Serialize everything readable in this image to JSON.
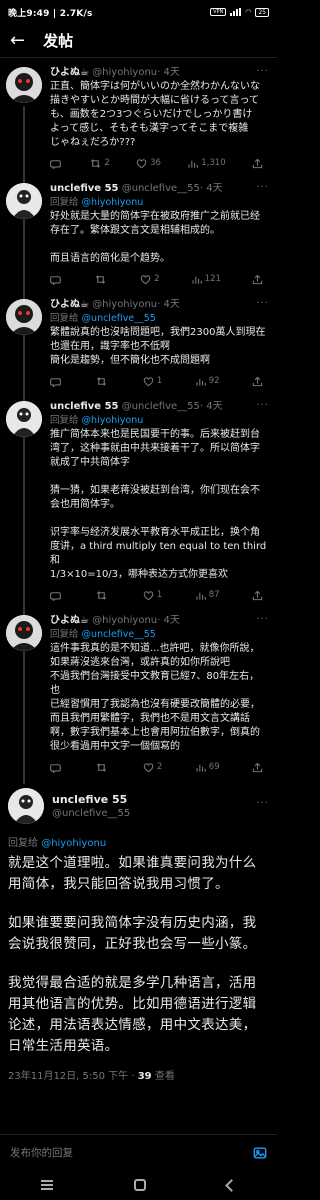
{
  "status_bar": {
    "time_speed": "晚上9:49 | 2.7K/s",
    "vpn": "VPN",
    "battery": "25"
  },
  "header": {
    "back_icon": "arrow-left-icon",
    "title": "发帖"
  },
  "tweets": [
    {
      "name": "ひよぬ☕",
      "handle": "@hiyohiyonu",
      "time": "· 4天",
      "reply_prefix": "",
      "reply_to": "",
      "lines": [
        "正直、簡体字は何がいいのか全然わかんないな",
        "描きやすいとか時間が大幅に省けるって言って",
        "も、画数を2つ3つぐらいだけでしっかり書け",
        "よって感じ、そもそも漢字ってそこまで複雑",
        "じゃねぇだろか???"
      ],
      "replies": "",
      "retweets": "2",
      "likes": "36",
      "views": "1,310"
    },
    {
      "name": "unclefive 55",
      "handle": "@unclefive__55",
      "time": "· 4天",
      "reply_prefix": "回复给",
      "reply_to": "@hiyohiyonu",
      "lines": [
        "好处就是大量的简体字在被政府推广之前就已经",
        "存在了。繁体跟文言文是相辅相成的。",
        "",
        "而且语言的简化是个趋势。"
      ],
      "replies": "",
      "retweets": "",
      "likes": "2",
      "views": "121"
    },
    {
      "name": "ひよぬ☕",
      "handle": "@hiyohiyonu",
      "time": "· 4天",
      "reply_prefix": "回复给",
      "reply_to": "@unclefive__55",
      "lines": [
        "繁體說真的也沒啥問題吧，我們2300萬人到現在",
        "也還在用，識字率也不低啊",
        "簡化是趨勢，但不簡化也不成問題啊"
      ],
      "replies": "",
      "retweets": "",
      "likes": "1",
      "views": "92"
    },
    {
      "name": "unclefive 55",
      "handle": "@unclefive__55",
      "time": "· 4天",
      "reply_prefix": "回复给",
      "reply_to": "@hiyohiyonu",
      "lines": [
        "推广简体本来也是民国要干的事。后来被赶到台",
        "湾了，这种事就由中共来接着干了。所以简体字",
        "就成了中共简体字",
        "",
        "猜一猜，如果老蒋没被赶到台湾，你们现在会不",
        "会也用简体字。",
        "",
        "识字率与经济发展水平教育水平成正比，换个角",
        "度讲，a third multiply ten equal to ten third和",
        "1/3×10=10/3，哪种表达方式你更喜欢"
      ],
      "replies": "",
      "retweets": "",
      "likes": "1",
      "views": "87"
    },
    {
      "name": "ひよぬ☕",
      "handle": "@hiyohiyonu",
      "time": "· 4天",
      "reply_prefix": "回复给",
      "reply_to": "@unclefive__55",
      "lines": [
        "這件事我真的是不知道...也許吧，就像你所說，",
        "如果蔣沒逃來台灣，或許真的如你所說吧",
        "不過我們台灣接受中文教育已經7、80年左右，也",
        "已經習慣用了我認為也沒有硬要改簡體的必要，",
        "而且我們用繁體字，我們也不是用文言文講話",
        "啊，數字我們基本上也會用阿拉伯數字，倒真的",
        "很少看過用中文字一個個寫的"
      ],
      "replies": "",
      "retweets": "",
      "likes": "2",
      "views": "69"
    }
  ],
  "main_tweet": {
    "name": "unclefive 55",
    "handle": "@unclefive__55",
    "reply_prefix": "回复给",
    "reply_to": "@hiyohiyonu",
    "paragraphs": [
      "就是这个道理啦。如果谁真要问我为什么用简体，我只能回答说我用习惯了。",
      "如果谁要要问我简体字没有历史内涵，我会说我很赞同，正好我也会写一些小篆。",
      "我觉得最合适的就是多学几种语言，活用用其他语言的优势。比如用德语进行逻辑论述，用法语表达情感，用中文表达美，日常生活用英语。"
    ],
    "timestamp": "23年11月12日, 5:50 下午 ·",
    "views_count": "39",
    "views_label": "查看"
  },
  "composer": {
    "placeholder": "发布你的回复",
    "icon": "image-icon"
  }
}
